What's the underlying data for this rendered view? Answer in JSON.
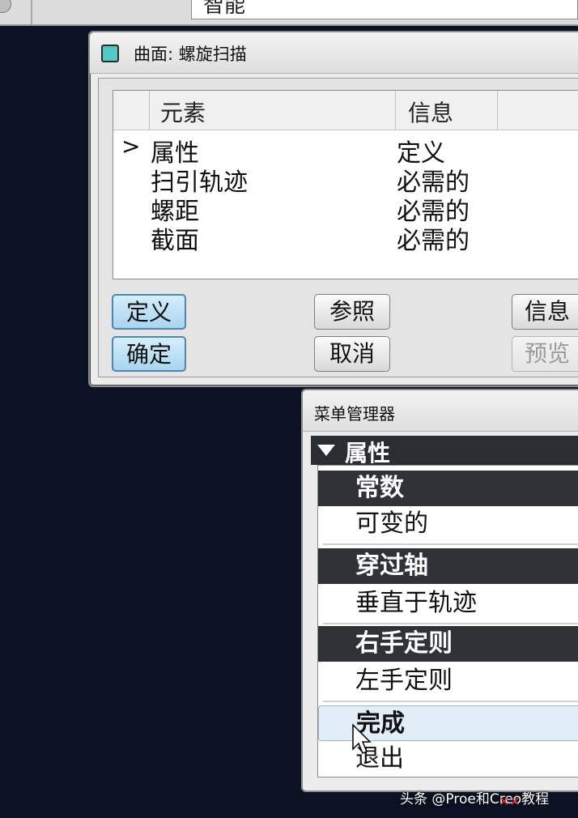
{
  "topbar": {
    "field_text": "智能"
  },
  "dialog1": {
    "title": "曲面: 螺旋扫描",
    "columns": [
      "元素",
      "信息"
    ],
    "rows": [
      {
        "marker": ">",
        "name": "属性",
        "info": "定义"
      },
      {
        "marker": "",
        "name": "扫引轨迹",
        "info": "必需的"
      },
      {
        "marker": "",
        "name": "螺距",
        "info": "必需的"
      },
      {
        "marker": "",
        "name": "截面",
        "info": "必需的"
      }
    ],
    "buttons": {
      "define": "定义",
      "ok": "确定",
      "refs": "参照",
      "cancel": "取消",
      "info": "信息",
      "preview": "预览"
    }
  },
  "menu_manager": {
    "title": "菜单管理器",
    "section": "属性",
    "items": [
      {
        "label": "常数",
        "state": "selected"
      },
      {
        "label": "可变的",
        "state": "normal"
      },
      {
        "label": "穿过轴",
        "state": "selected"
      },
      {
        "label": "垂直于轨迹",
        "state": "normal"
      },
      {
        "label": "右手定则",
        "state": "selected"
      },
      {
        "label": "左手定则",
        "state": "normal"
      },
      {
        "label": "完成",
        "state": "done"
      },
      {
        "label": "退出",
        "state": "normal"
      }
    ]
  },
  "watermark": "头条 @Proe和Creo教程",
  "colors": {
    "desktop": "#0a1224",
    "selection": "#2f3338",
    "primary_button": "#a9d4ef",
    "icon": "#54c9c4"
  }
}
